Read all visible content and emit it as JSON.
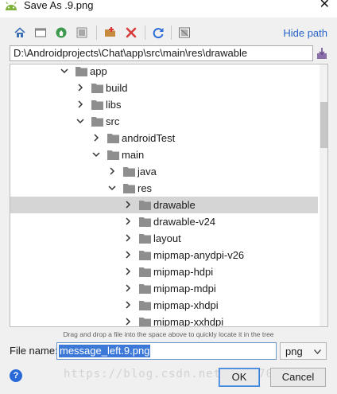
{
  "window": {
    "title": "Save As .9.png",
    "close_glyph": "✕"
  },
  "toolbar": {
    "icons": [
      "home-icon",
      "desktop-icon",
      "project-icon",
      "module-icon",
      "new-folder-icon",
      "delete-icon",
      "refresh-icon",
      "show-hidden-icon"
    ],
    "hide_path_label": "Hide path"
  },
  "path": {
    "value": "D:\\Androidprojects\\Chat\\app\\src\\main\\res\\drawable"
  },
  "tree": {
    "items": [
      {
        "label": "app",
        "expanded": true,
        "depth": 0
      },
      {
        "label": "build",
        "expanded": false,
        "depth": 1
      },
      {
        "label": "libs",
        "expanded": false,
        "depth": 1
      },
      {
        "label": "src",
        "expanded": true,
        "depth": 1
      },
      {
        "label": "androidTest",
        "expanded": false,
        "depth": 2
      },
      {
        "label": "main",
        "expanded": true,
        "depth": 2
      },
      {
        "label": "java",
        "expanded": false,
        "depth": 3
      },
      {
        "label": "res",
        "expanded": true,
        "depth": 3
      },
      {
        "label": "drawable",
        "expanded": false,
        "depth": 4,
        "selected": true
      },
      {
        "label": "drawable-v24",
        "expanded": false,
        "depth": 4
      },
      {
        "label": "layout",
        "expanded": false,
        "depth": 4
      },
      {
        "label": "mipmap-anydpi-v26",
        "expanded": false,
        "depth": 4
      },
      {
        "label": "mipmap-hdpi",
        "expanded": false,
        "depth": 4
      },
      {
        "label": "mipmap-mdpi",
        "expanded": false,
        "depth": 4
      },
      {
        "label": "mipmap-xhdpi",
        "expanded": false,
        "depth": 4
      },
      {
        "label": "mipmap-xxhdpi",
        "expanded": false,
        "depth": 4
      }
    ]
  },
  "hint": "Drag and drop a file into the space above to quickly locate it in the tree",
  "filename": {
    "label": "File name:",
    "value": "message_left.9.png"
  },
  "extension": {
    "selected": "png"
  },
  "buttons": {
    "help": "?",
    "ok": "OK",
    "cancel": "Cancel"
  },
  "watermark": "https://blog.csdn.net/qq_37060660",
  "colors": {
    "accent": "#2663c8",
    "selection": "#d5d5d5",
    "folder": "#8e8e8e",
    "filename_highlight": "#3b78d8"
  }
}
